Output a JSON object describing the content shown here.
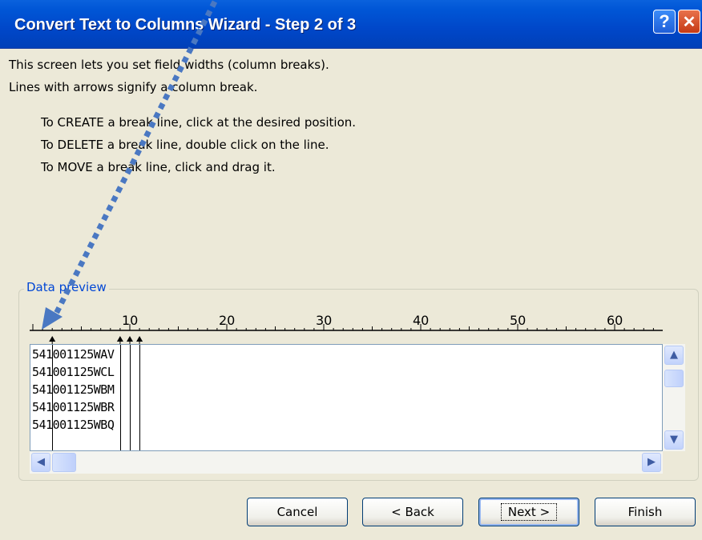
{
  "window": {
    "title": "Convert Text to Columns Wizard - Step 2 of 3",
    "help_glyph": "?",
    "close_glyph": "✕"
  },
  "intro": {
    "line1": "This screen lets you set field widths (column breaks).",
    "line2": "Lines with arrows signify a column break."
  },
  "instructions": [
    "To CREATE a break line, click at the desired position.",
    "To DELETE a break line, double click on the line.",
    "To MOVE a break line, click and drag it."
  ],
  "preview": {
    "group_label": "Data preview",
    "ruler_labels": [
      "10",
      "20",
      "30",
      "40",
      "50",
      "60"
    ],
    "rows": [
      "541001125WAV",
      "541001125WCL",
      "541001125WBM",
      "541001125WBR",
      "541001125WBQ"
    ],
    "break_positions": [
      2,
      9,
      10,
      11
    ]
  },
  "buttons": {
    "cancel": "Cancel",
    "back": "< Back",
    "next": "Next >",
    "finish": "Finish"
  },
  "colors": {
    "titlebar": "#0A62DD",
    "dialog_bg": "#ECE9D8",
    "group_label": "#0046D5",
    "annotation_arrow": "#4A78C2"
  },
  "icons": {
    "help": "help-icon",
    "close": "close-icon",
    "scroll_up": "chevron-up-icon",
    "scroll_down": "chevron-down-icon",
    "scroll_left": "chevron-left-icon",
    "scroll_right": "chevron-right-icon"
  }
}
